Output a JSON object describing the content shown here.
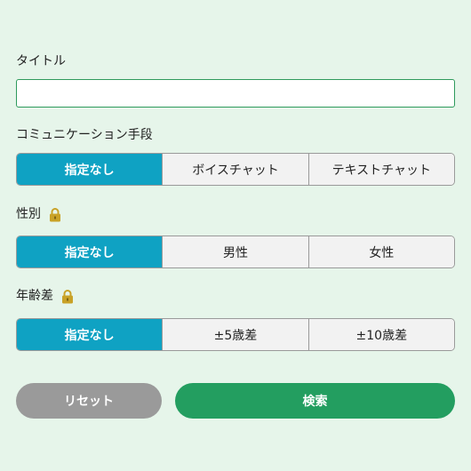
{
  "form": {
    "title": {
      "label": "タイトル",
      "value": "",
      "placeholder": ""
    },
    "communication": {
      "label": "コミュニケーション手段",
      "options": [
        "指定なし",
        "ボイスチャット",
        "テキストチャット"
      ],
      "selected": "指定なし"
    },
    "gender": {
      "label": "性別",
      "locked_icon": "lock-icon",
      "options": [
        "指定なし",
        "男性",
        "女性"
      ],
      "selected": "指定なし"
    },
    "age_gap": {
      "label": "年齢差",
      "locked_icon": "lock-icon",
      "options": [
        "指定なし",
        "±5歳差",
        "±10歳差"
      ],
      "selected": "指定なし"
    },
    "buttons": {
      "reset": "リセット",
      "search": "検索"
    }
  },
  "colors": {
    "background": "#e6f5ea",
    "selected": "#0fa2c3",
    "search_button": "#239e60",
    "reset_button": "#9a9a9a",
    "lock": "#c9a227"
  }
}
